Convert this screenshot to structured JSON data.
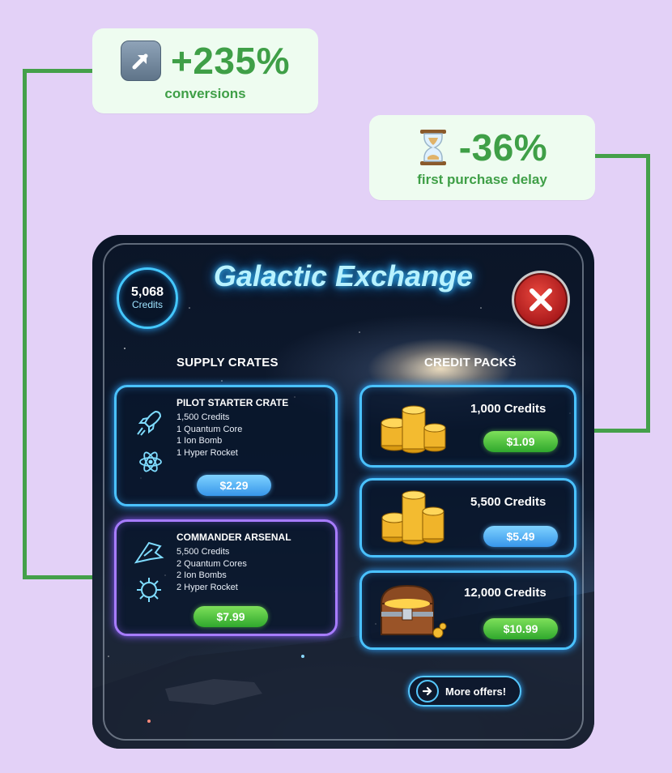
{
  "callouts": {
    "conversions": {
      "icon": "up-right-arrow-icon",
      "value": "+235%",
      "label": "conversions"
    },
    "delay": {
      "icon": "hourglass-icon",
      "value": "-36%",
      "label": "first purchase delay"
    }
  },
  "colors": {
    "accent_green": "#44a04a",
    "background": "#e3d1f7",
    "neon_blue": "#4ac2ff",
    "neon_purple": "#a77cff"
  },
  "shop": {
    "title": "Galactic Exchange",
    "balance": {
      "amount": "5,068",
      "unit": "Credits"
    },
    "close_icon": "close-icon",
    "supply_heading": "SUPPLY CRATES",
    "credit_heading": "CREDIT PACKS",
    "crates": [
      {
        "name": "PILOT STARTER CRATE",
        "items": [
          "1,500 Credits",
          "1 Quantum Core",
          "1 Ion Bomb",
          "1 Hyper Rocket"
        ],
        "price": "$2.29",
        "icons": [
          "rocket-icon",
          "atom-icon"
        ]
      },
      {
        "name": "COMMANDER ARSENAL",
        "items": [
          "5,500 Credits",
          "2 Quantum Cores",
          "2 Ion Bombs",
          "2 Hyper Rocket"
        ],
        "price": "$7.99",
        "icons": [
          "spaceship-icon",
          "bomb-icon"
        ]
      }
    ],
    "packs": [
      {
        "label": "1,000 Credits",
        "price": "$1.09",
        "icon": "coin-stack-icon"
      },
      {
        "label": "5,500 Credits",
        "price": "$5.49",
        "icon": "coin-stack-icon"
      },
      {
        "label": "12,000 Credits",
        "price": "$10.99",
        "icon": "treasure-chest-icon"
      }
    ],
    "more_offers": "More offers!"
  }
}
